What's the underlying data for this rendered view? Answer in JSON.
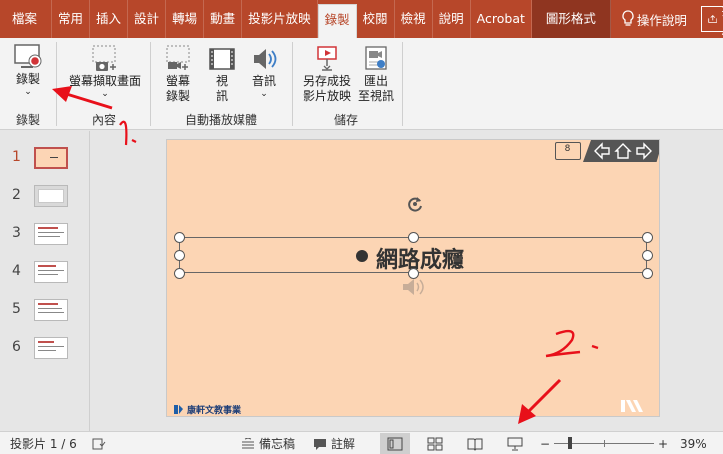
{
  "tabs": [
    {
      "label": "檔案"
    },
    {
      "label": "常用"
    },
    {
      "label": "插入"
    },
    {
      "label": "設計"
    },
    {
      "label": "轉場"
    },
    {
      "label": "動畫"
    },
    {
      "label": "投影片放映"
    },
    {
      "label": "錄製"
    },
    {
      "label": "校閱"
    },
    {
      "label": "檢視"
    },
    {
      "label": "說明"
    },
    {
      "label": "Acrobat"
    },
    {
      "label": "圖形格式"
    }
  ],
  "tell_me": "操作說明",
  "share": "共用",
  "ribbon": {
    "record_label": "錄製",
    "record_group": "錄製",
    "screenshot_label": "螢幕擷取畫面",
    "content_group": "內容",
    "screen_record_line1": "螢幕",
    "screen_record_line2": "錄製",
    "video_line1": "視",
    "video_line2": "訊",
    "audio_label": "音訊",
    "automedia_group": "自動播放媒體",
    "save_show_line1": "另存成投",
    "save_show_line2": "影片放映",
    "export_line1": "匯出",
    "export_line2": "至視訊",
    "save_group": "儲存"
  },
  "thumbnails": [
    {
      "num": "1"
    },
    {
      "num": "2"
    },
    {
      "num": "3"
    },
    {
      "num": "4"
    },
    {
      "num": "5"
    },
    {
      "num": "6"
    }
  ],
  "slide": {
    "book_page": "8",
    "title": "網路成癮",
    "publisher": "康軒文教事業"
  },
  "annotations": {
    "mark1": "1.",
    "mark2": "2."
  },
  "status": {
    "slide_counter": "投影片 1 / 6",
    "notes": "備忘稿",
    "comments": "註解",
    "zoom": "39%",
    "zoom_minus": "−",
    "zoom_plus": "+"
  },
  "colors": {
    "brand": "#b7472a",
    "slide_bg": "#fcd5b4",
    "annotation": "#e8101a"
  }
}
